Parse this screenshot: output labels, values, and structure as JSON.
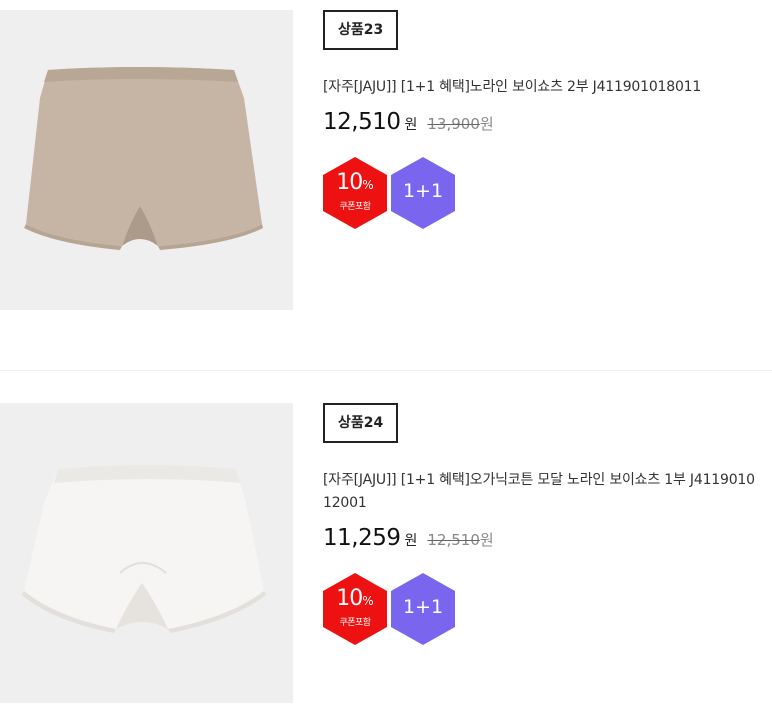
{
  "products": [
    {
      "rank_label": "상품23",
      "title": "[자주[JAJU]] [1+1 혜택]노라인 보이쇼츠 2부 J411901018011",
      "price": "12,510",
      "currency": "원",
      "original_price": "13,900",
      "original_currency": "원",
      "coupon_badge": {
        "percent": "10",
        "percent_sign": "%",
        "label": "쿠폰포함",
        "color": "#ee1111"
      },
      "plus_badge": {
        "label": "1+1",
        "color": "#7a66ee"
      },
      "image_color": "#c9b8a8"
    },
    {
      "rank_label": "상품24",
      "title": "[자주[JAJU]] [1+1 혜택]오가닉코튼 모달 노라인 보이쇼츠 1부 J411901012001",
      "price": "11,259",
      "currency": "원",
      "original_price": "12,510",
      "original_currency": "원",
      "coupon_badge": {
        "percent": "10",
        "percent_sign": "%",
        "label": "쿠폰포함",
        "color": "#ee1111"
      },
      "plus_badge": {
        "label": "1+1",
        "color": "#7a66ee"
      },
      "image_color": "#f4f3f1"
    }
  ]
}
